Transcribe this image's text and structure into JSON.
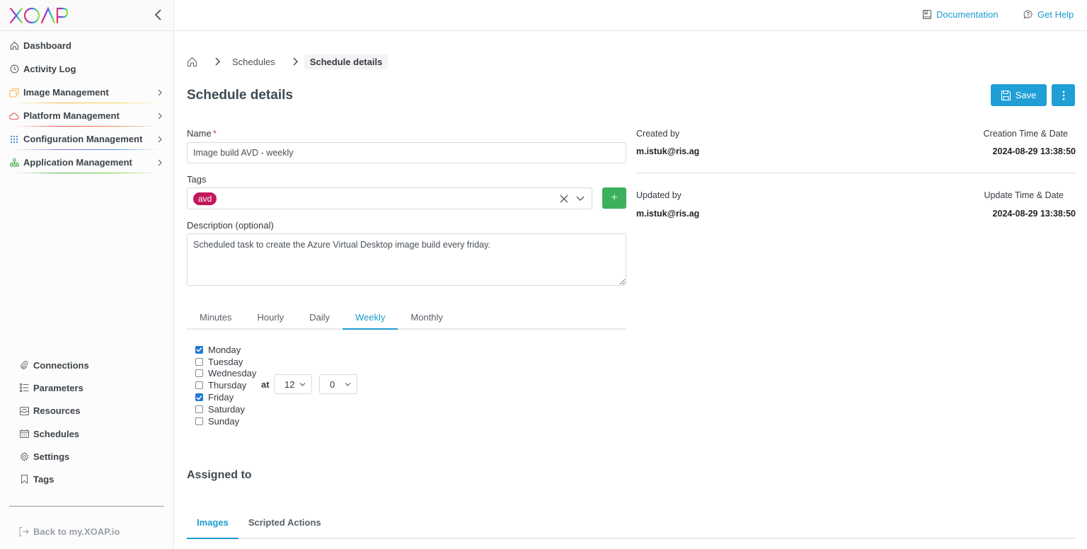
{
  "app": {
    "logo_text": "XOAP",
    "logo_colors": [
      "#e8336d",
      "#8e2de2",
      "#1fb6c9",
      "#7bd13d"
    ]
  },
  "sidebar": {
    "primary_items": [
      {
        "label": "Dashboard",
        "icon": "home-icon",
        "has_submenu": false
      },
      {
        "label": "Activity Log",
        "icon": "clock-icon",
        "has_submenu": false
      },
      {
        "label": "Image Management",
        "icon": "images-icon",
        "has_submenu": true,
        "accent": "#f5b84a"
      },
      {
        "label": "Platform Management",
        "icon": "cloud-icon",
        "has_submenu": true,
        "accent": "#e8584a"
      },
      {
        "label": "Configuration Management",
        "icon": "grid-icon",
        "has_submenu": true,
        "accent": "#4a90e2"
      },
      {
        "label": "Application Management",
        "icon": "sitemap-icon",
        "has_submenu": true,
        "accent": "#4caf50"
      }
    ],
    "secondary_items": [
      {
        "label": "Connections",
        "icon": "paperclip-icon"
      },
      {
        "label": "Parameters",
        "icon": "list-icon"
      },
      {
        "label": "Resources",
        "icon": "inbox-icon"
      },
      {
        "label": "Schedules",
        "icon": "calendar-icon"
      },
      {
        "label": "Settings",
        "icon": "gear-icon"
      },
      {
        "label": "Tags",
        "icon": "bookmark-icon"
      }
    ],
    "back_link": "Back to my.XOAP.io"
  },
  "topbar": {
    "documentation": "Documentation",
    "get_help": "Get Help",
    "link_color": "#1b9bd1"
  },
  "breadcrumb": {
    "items": [
      "Schedules",
      "Schedule details"
    ]
  },
  "page": {
    "title": "Schedule details",
    "save_label": "Save",
    "primary_color": "#1f9fd6"
  },
  "form": {
    "name_label": "Name",
    "name_required_mark": "*",
    "name_value": "Image build AVD - weekly",
    "tags_label": "Tags",
    "tags": [
      {
        "label": "avd",
        "color": "#c2185b"
      }
    ],
    "add_tag_symbol": "+",
    "description_label": "Description (optional)",
    "description_value": "Scheduled task to create the Azure Virtual Desktop image build every friday."
  },
  "frequency_tabs": {
    "items": [
      "Minutes",
      "Hourly",
      "Daily",
      "Weekly",
      "Monthly"
    ],
    "active": "Weekly"
  },
  "weekly": {
    "days": [
      {
        "label": "Monday",
        "checked": true
      },
      {
        "label": "Tuesday",
        "checked": false
      },
      {
        "label": "Wednesday",
        "checked": false
      },
      {
        "label": "Thursday",
        "checked": false
      },
      {
        "label": "Friday",
        "checked": true
      },
      {
        "label": "Saturday",
        "checked": false
      },
      {
        "label": "Sunday",
        "checked": false
      }
    ],
    "at_label": "at",
    "hour": "12",
    "minute": "0"
  },
  "meta": {
    "created_by_label": "Created by",
    "created_by": "m.istuk@ris.ag",
    "creation_time_label": "Creation Time & Date",
    "creation_time": "2024-08-29 13:38:50",
    "updated_by_label": "Updated by",
    "updated_by": "m.istuk@ris.ag",
    "update_time_label": "Update Time & Date",
    "update_time": "2024-08-29 13:38:50"
  },
  "assigned": {
    "title": "Assigned to",
    "tabs": [
      "Images",
      "Scripted Actions"
    ],
    "active": "Images"
  }
}
